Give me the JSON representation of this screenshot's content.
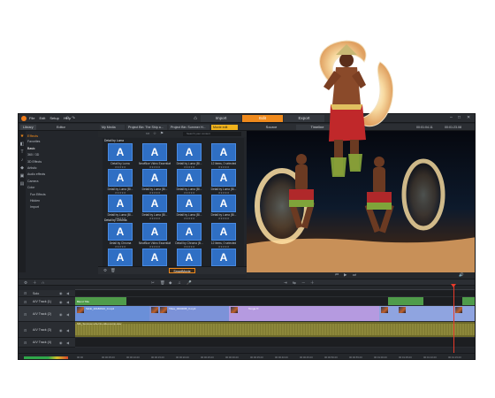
{
  "app": {
    "menu": [
      "File",
      "Edit",
      "Setup",
      "Help"
    ],
    "mode_tabs": [
      "Import",
      "Edit",
      "Export"
    ],
    "active_mode": "Edit"
  },
  "left_panel": {
    "tabs": [
      "Library",
      "Editor"
    ],
    "tree": [
      {
        "label": "Effects",
        "kind": "head"
      },
      {
        "label": "Favorites",
        "kind": "item"
      },
      {
        "label": "Basic",
        "kind": "sel"
      },
      {
        "label": "360 / 3D",
        "kind": "item"
      },
      {
        "label": "3D Effects",
        "kind": "item"
      },
      {
        "label": "Artistic",
        "kind": "item"
      },
      {
        "label": "Audio effects",
        "kind": "item"
      },
      {
        "label": "Camera",
        "kind": "item"
      },
      {
        "label": "Color",
        "kind": "item"
      },
      {
        "label": "Fun Effects",
        "kind": "sub"
      },
      {
        "label": "Hidden",
        "kind": "sub"
      },
      {
        "label": "Import",
        "kind": "sub"
      }
    ]
  },
  "library": {
    "tabs": [
      "My Media",
      "Project Bin: The Ship a...",
      "Project Bin: Summer H...",
      "Movie edit"
    ],
    "search_placeholder": "Search your content",
    "group_labels": [
      "Detail by Luma",
      "Detail by Chroma"
    ],
    "row_labels": [
      [
        "Detail by Luma",
        "NewBlue Video Essentials VII",
        "Detail by Luma (Bl...",
        "12 items, 0 selected"
      ],
      [
        "Detail by Luma (Bl...",
        "Detail by Luma (Bl...",
        "Detail by Luma (Bl...",
        "Detail by Luma (Bl..."
      ],
      [
        "Detail by Luma (Bl...",
        "Detail by Luma (Bl...",
        "Detail by Luma (Bl...",
        "Detail by Luma (Bl..."
      ],
      [
        "Detail by Chroma",
        "NewBlue Video Essentials VII",
        "Detail by Chroma (B...",
        "12 items, 0 selected"
      ],
      [
        "Detail by Chroma",
        "Detail by Chroma (B...",
        "Detail by Chroma (B...",
        "Detail by Chroma (B..."
      ]
    ],
    "tile_glyph": "A",
    "stars": "★★★★★",
    "smart_movie": "SmartMovie"
  },
  "player": {
    "tabs": [
      "Source",
      "Timeline"
    ],
    "timecode_left": "00:01:04.11",
    "timecode_right": "00:01:23.08"
  },
  "timeline": {
    "tracks": [
      {
        "name": "Solo"
      },
      {
        "name": "A/V Track (1)"
      },
      {
        "name": "A/V Track (2)"
      },
      {
        "name": "A/V Track (3)"
      },
      {
        "name": "A/V Track (4)"
      }
    ],
    "clips": {
      "title_clip": "Blend Title",
      "video_clip_1": "Tahiti_20180610_0.mp4",
      "video_clip_2": "Titles_0000088_0.mp4",
      "video_clip_3": "Tonga Tr",
      "audio_clip": "MR_Summer-Life-No-video-temp.wav"
    },
    "ruler_ticks": [
      "00:00",
      "00:00:05.00",
      "00:00:10.00",
      "00:00:15.00",
      "00:00:20.00",
      "00:00:25.00",
      "00:00:30.00",
      "00:00:35.00",
      "00:00:40.00",
      "00:00:45.00",
      "00:00:50.00",
      "00:00:55.00",
      "00:01:00.00",
      "00:01:05.00",
      "00:01:10.00",
      "00:01:15.00"
    ]
  },
  "colors": {
    "accent": "#f08a1c",
    "tile_blue": "#2f6fc4",
    "video_clip": "#9b8fd8",
    "audio_clip": "#8d8838",
    "playhead": "#e83a2a"
  }
}
